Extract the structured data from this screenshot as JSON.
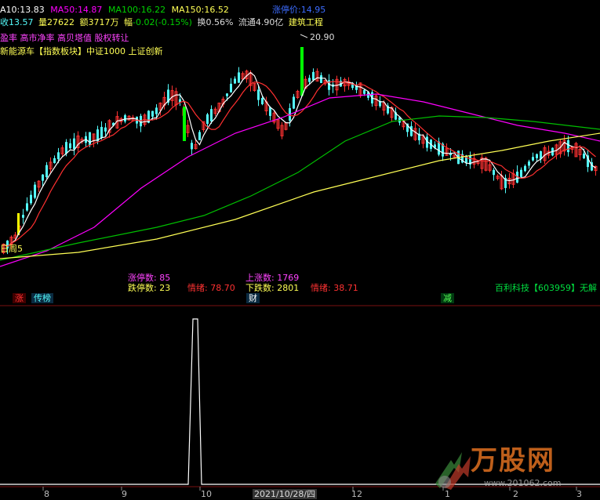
{
  "ma_row": {
    "ma10": "A10:13.83",
    "ma50": "MA50:14.87",
    "ma100": "MA100:16.22",
    "ma150": "MA150:16.52",
    "limit_up_price": "涨停价:14.95"
  },
  "quote_row": {
    "close": "收13.57",
    "volume": "量27622",
    "amount": "额3717万",
    "change_label": "幅",
    "change": "-0.02(-0.15%)",
    "turnover": "换0.56%",
    "float_cap": "流通4.90亿",
    "industry": "建筑工程"
  },
  "concept_row1": "盈率 高市净率 高贝塔值 股权转让",
  "concept_row2": "新能源车【指数板块】中证1000 上证创新",
  "high_price_label": "20.90",
  "week_label": "日周5",
  "market_stats": {
    "limit_up_label": "涨停数: 85",
    "limit_down_label": "跌停数: 23",
    "sentiment1": "情绪: 78.70",
    "up_label": "上涨数: 1769",
    "down_label": "下跌数: 2801",
    "sentiment2": "情绪: 38.71"
  },
  "tags": {
    "zhang": "涨",
    "chuanbang": "传榜",
    "cai": "财",
    "jian": "减"
  },
  "stock_info": "百利科技【603959】无解",
  "date_axis": {
    "d8": "8",
    "d9": "9",
    "d10": "10",
    "current": "2021/10/28/四",
    "d12": "12",
    "d1": "1",
    "d2": "2",
    "d3": "3"
  },
  "watermark": {
    "brand": "万股网",
    "site": "www.201062.com"
  },
  "colors": {
    "up": "#ff3232",
    "down": "#54fcfc",
    "ma10": "#ffffff",
    "ma_red": "#ff3030",
    "ma50": "#ff00ff",
    "ma100": "#00c000",
    "ma150": "#ffff55"
  }
}
